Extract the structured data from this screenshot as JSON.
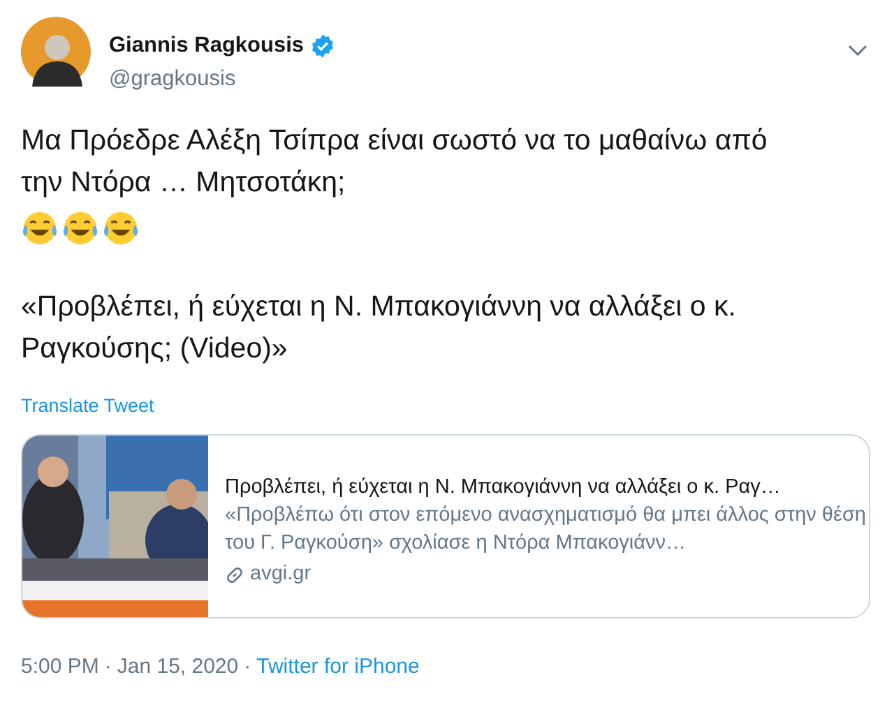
{
  "author": {
    "name": "Giannis Ragkousis",
    "verified": true,
    "handle": "@gragkousis"
  },
  "tweet": {
    "paragraphs": [
      "Μα Πρόεδρε Αλέξη Τσίπρα είναι σωστό να το μαθαίνω από την Ντόρα … Μητσοτάκη;"
    ],
    "emojis": [
      {
        "kind": "tears-of-joy"
      },
      {
        "kind": "tears-of-joy"
      },
      {
        "kind": "tears-of-joy"
      }
    ],
    "quote": "«Προβλέπει, ή εύχεται η Ν. Μπακογιάννη να αλλάξει ο κ. Ραγκούσης; (Video)»"
  },
  "translate_link": "Translate Tweet",
  "link_card": {
    "title": "Προβλέπει, ή εύχεται η Ν. Μπακογιάννη να αλλάξει ο κ. Ραγ…",
    "description": "«Προβλέπω ότι στον επόμενο ανασχηματισμό θα μπει άλλος στην θέση του Γ. Ραγκούση» σχολίασε η Ντόρα Μπακογιάνν…",
    "domain": "avgi.gr"
  },
  "footer": {
    "time": "5:00 PM",
    "separator_1": "·",
    "date": "Jan 15, 2020",
    "separator_2": "·",
    "source": "Twitter for iPhone"
  }
}
